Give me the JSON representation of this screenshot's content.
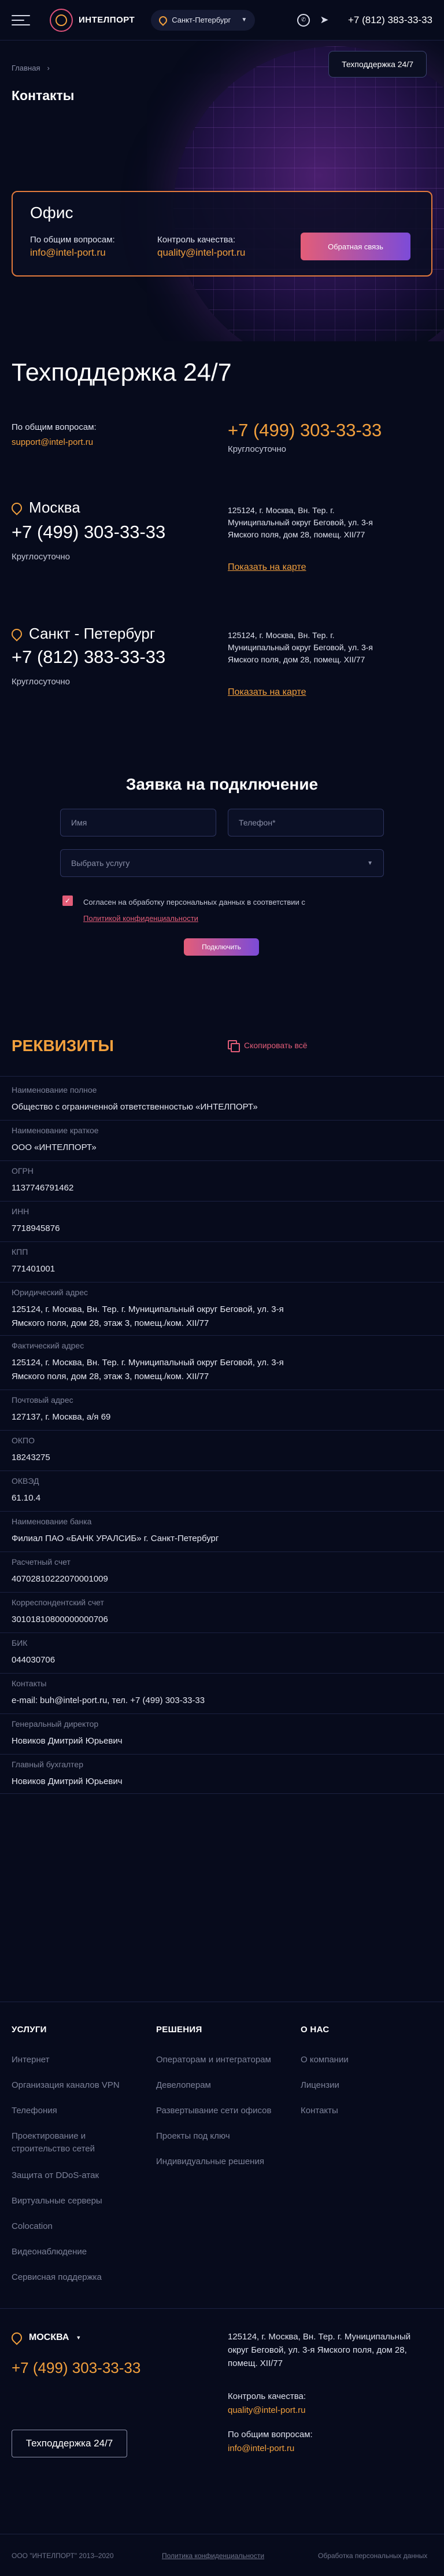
{
  "header": {
    "logo_text": "ИНТЕЛПОРТ",
    "city": "Санкт-Петербург",
    "phone": "+7 (812) 383-33-33",
    "support_button": "Техподдержка 24/7"
  },
  "breadcrumb": {
    "home": "Главная",
    "sep": "›"
  },
  "page_title": "Контакты",
  "office": {
    "title": "Офис",
    "general_label": "По общим вопросам:",
    "general_email": "info@intel-port.ru",
    "quality_label": "Контроль качества:",
    "quality_email": "quality@intel-port.ru",
    "feedback_button": "Обратная связь"
  },
  "support": {
    "title": "Техподдержка 24/7",
    "general_label": "По общим вопросам:",
    "email": "support@intel-port.ru",
    "phone": "+7 (499) 303-33-33",
    "hours": "Круглосуточно"
  },
  "offices": [
    {
      "city": "Москва",
      "phone": "+7 (499) 303-33-33",
      "hours": "Круглосуточно",
      "address": "125124, г. Москва, Вн. Тер. г. Муниципальный округ Беговой, ул. 3-я Ямского поля, дом 28, помещ. XII/77",
      "map_link": "Показать на карте"
    },
    {
      "city": "Санкт - Петербург",
      "phone": "+7 (812) 383-33-33",
      "hours": "Круглосуточно",
      "address": "125124, г. Москва, Вн. Тер. г. Муниципальный округ Беговой, ул. 3-я Ямского поля, дом 28, помещ. XII/77",
      "map_link": "Показать на карте"
    }
  ],
  "form": {
    "title": "Заявка на подключение",
    "name_placeholder": "Имя",
    "phone_placeholder": "Телефон*",
    "service_placeholder": "Выбрать услугу",
    "consent_text": "Согласен на обработку персональных данных в соответствии с",
    "consent_link": "Политикой конфиденциальности",
    "submit": "Подключить",
    "checked": true
  },
  "requisites": {
    "title": "РЕКВИЗИТЫ",
    "copy_label": "Скопировать всё",
    "rows": [
      {
        "label": "Наименование полное",
        "value": "Общество с ограниченной ответственностью «ИНТЕЛПОРТ»"
      },
      {
        "label": "Наименование краткое",
        "value": "ООО «ИНТЕЛПОРТ»"
      },
      {
        "label": "ОГРН",
        "value": "1137746791462"
      },
      {
        "label": "ИНН",
        "value": "7718945876"
      },
      {
        "label": "КПП",
        "value": "771401001"
      },
      {
        "label": "Юридический адрес",
        "value": "125124, г. Москва, Вн. Тер. г. Муниципальный округ Беговой, ул. 3-я Ямского поля, дом 28, этаж 3, помещ./ком. XII/77"
      },
      {
        "label": "Фактический адрес",
        "value": "125124, г. Москва, Вн. Тер. г. Муниципальный округ Беговой, ул. 3-я Ямского поля, дом 28, этаж 3, помещ./ком. XII/77"
      },
      {
        "label": "Почтовый адрес",
        "value": "127137, г. Москва, а/я 69"
      },
      {
        "label": "ОКПО",
        "value": "18243275"
      },
      {
        "label": "ОКВЭД",
        "value": "61.10.4"
      },
      {
        "label": "Наименование банка",
        "value": "Филиал ПАО «БАНК УРАЛСИБ» г. Санкт-Петербург"
      },
      {
        "label": "Расчетный счет",
        "value": "40702810222070001009"
      },
      {
        "label": "Корреспондентский счет",
        "value": "30101810800000000706"
      },
      {
        "label": "БИК",
        "value": "044030706"
      },
      {
        "label": "Контакты",
        "value": "e-mail: buh@intel-port.ru, тел. +7 (499) 303-33-33"
      },
      {
        "label": "Генеральный директор",
        "value": "Новиков Дмитрий Юрьевич"
      },
      {
        "label": "Главный бухгалтер",
        "value": "Новиков Дмитрий Юрьевич"
      }
    ]
  },
  "footer": {
    "cols": [
      {
        "title": "УСЛУГИ",
        "items": [
          "Интернет",
          "Организация каналов VPN",
          "Телефония",
          "Проектирование и строительство сетей",
          "Защита от DDoS-атак",
          "Виртуальные серверы",
          "Colocation",
          "Видеонаблюдение",
          "Сервисная поддержка"
        ]
      },
      {
        "title": "РЕШЕНИЯ",
        "items": [
          "Операторам и интеграторам",
          "Девелоперам",
          "Развертывание сети офисов",
          "Проекты под ключ",
          "Индивидуальные решения"
        ]
      },
      {
        "title": "О НАС",
        "items": [
          "О компании",
          "Лицензии",
          "Контакты"
        ]
      }
    ],
    "city": "МОСКВА",
    "phone": "+7 (499) 303-33-33",
    "support_button": "Техподдержка 24/7",
    "address": "125124, г. Москва, Вн. Тер. г. Муниципальный округ Беговой, ул. 3-я Ямского поля, дом 28, помещ. XII/77",
    "quality_label": "Контроль качества:",
    "quality_email": "quality@intel-port.ru",
    "general_label": "По общим вопросам:",
    "general_email": "info@intel-port.ru",
    "copyright": "ООО \"ИНТЕЛПОРТ\" 2013–2020",
    "privacy": "Политика конфиденциальности",
    "personal": "Обработка персональных данных"
  }
}
